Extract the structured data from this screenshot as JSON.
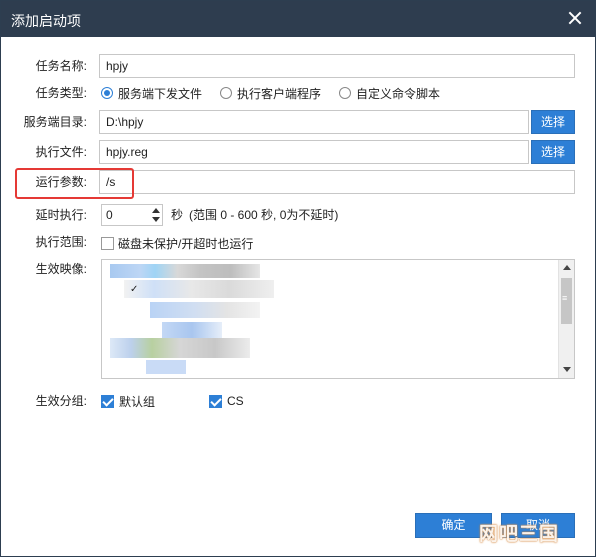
{
  "window": {
    "title": "添加启动项"
  },
  "form": {
    "task_name": {
      "label": "任务名称:",
      "value": "hpjy"
    },
    "task_type": {
      "label": "任务类型:",
      "options": [
        "服务端下发文件",
        "执行客户端程序",
        "自定义命令脚本"
      ],
      "selected_index": 0
    },
    "server_dir": {
      "label": "服务端目录:",
      "value": "D:\\hpjy",
      "button": "选择"
    },
    "exec_file": {
      "label": "执行文件:",
      "value": "hpjy.reg",
      "button": "选择"
    },
    "run_params": {
      "label": "运行参数:",
      "value": "/s"
    },
    "delay": {
      "label": "延时执行:",
      "value": "0",
      "unit": "秒",
      "hint": "(范围 0 - 600 秒, 0为不延时)"
    },
    "scope": {
      "label": "执行范围:",
      "checkbox_label": "磁盘未保护/开超时也运行",
      "checked": false
    },
    "images": {
      "label": "生效映像:"
    },
    "groups": {
      "label": "生效分组:",
      "items": [
        {
          "label": "默认组",
          "checked": true
        },
        {
          "label": "CS",
          "checked": true
        }
      ]
    }
  },
  "footer": {
    "ok": "确定",
    "cancel": "取消"
  },
  "watermark": "网吧三国",
  "colors": {
    "titlebar": "#2e3d4f",
    "accent": "#2d7fd6",
    "highlight": "#e53935"
  },
  "icons": {
    "close": "close-icon"
  }
}
